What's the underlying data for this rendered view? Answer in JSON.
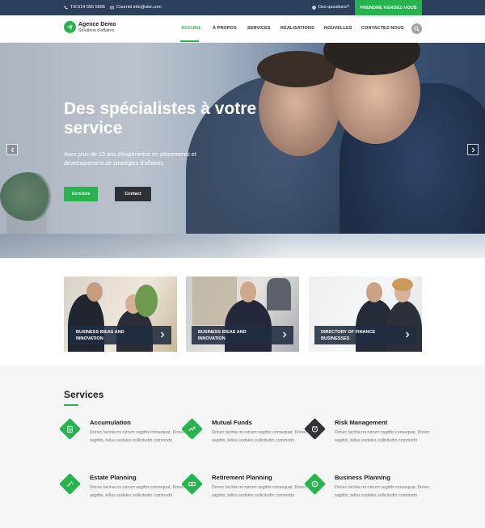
{
  "topbar": {
    "phone": "Tél 514 555 5666",
    "email": "Courriel info@site.com",
    "questions": "Des questions?",
    "cta": "PRENDRE RENDEZ-VOUS"
  },
  "header": {
    "logo_name": "Agence Demo",
    "logo_tagline": "Solutions d'affaires",
    "nav": [
      "ACCUEIL",
      "À PROPOS",
      "SERVICES",
      "RÉALISATIONS",
      "NOUVELLES",
      "CONTACTEZ-NOUS"
    ],
    "active_nav": "ACCUEIL"
  },
  "hero": {
    "title": "Des spécialistes à votre service",
    "subtitle": "Avec plus de 15 ans d'expérience en placements et développement de stratégies d'affaires",
    "btn_primary": "Services",
    "btn_secondary": "Contact"
  },
  "cards": [
    {
      "label": "BUSINESS IDEAS AND INNOVATION"
    },
    {
      "label": "BUSINESS IDEAS AND INNOVATION"
    },
    {
      "label": "DIRECTORY OF FINANCE BUSINESSES"
    }
  ],
  "services": {
    "heading": "Services",
    "items": [
      {
        "name": "Accumulation",
        "desc": "Donec lacinia mi rutrum sagittis consequat. Donec sagittis, tellus sodales sollicitudin commodo",
        "icon": "clipboard-icon",
        "style": "green"
      },
      {
        "name": "Mutual Funds",
        "desc": "Donec lacinia mi rutrum sagittis consequat. Donec sagittis, tellus sodales sollicitudin commodo",
        "icon": "trend-chart-icon",
        "style": "green"
      },
      {
        "name": "Risk Management",
        "desc": "Donec lacinia mi rutrum sagittis consequat. Donec sagittis, tellus sodales sollicitudin commodo",
        "icon": "alarm-clock-icon",
        "style": "dark"
      },
      {
        "name": "Estate Planning",
        "desc": "Donec lacinia mi rutrum sagittis consequat. Donec sagittis, tellus sodales sollicitudin commodo",
        "icon": "magic-wand-icon",
        "style": "green"
      },
      {
        "name": "Retirement Planning",
        "desc": "Donec lacinia mi rutrum sagittis consequat. Donec sagittis, tellus sodales sollicitudin commodo",
        "icon": "cash-icon",
        "style": "green"
      },
      {
        "name": "Business Planning",
        "desc": "Donec lacinia mi rutrum sagittis consequat. Donec sagittis, tellus sodales sollicitudin commodo",
        "icon": "globe-icon",
        "style": "green"
      }
    ]
  },
  "colors": {
    "accent": "#27b44f",
    "topbar": "#2b3e5c",
    "dark": "#2d3136"
  }
}
